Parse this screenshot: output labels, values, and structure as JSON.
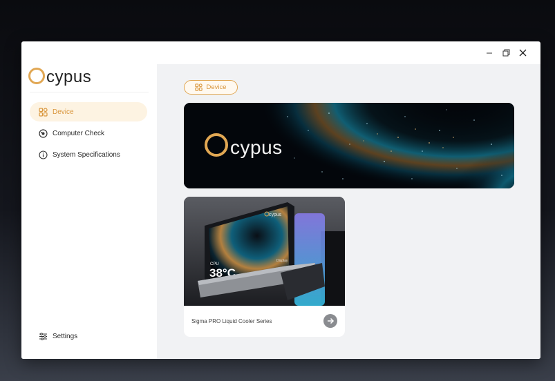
{
  "app": {
    "logo_text": "cypus"
  },
  "window_controls": [
    "minimize-icon",
    "restore-icon",
    "close-icon"
  ],
  "sidebar": {
    "items": [
      {
        "label": "Device",
        "icon": "grid-icon",
        "active": true
      },
      {
        "label": "Computer Check",
        "icon": "gauge-icon",
        "active": false
      },
      {
        "label": "System Specifications",
        "icon": "info-icon",
        "active": false
      }
    ],
    "settings_label": "Settings"
  },
  "main": {
    "device_pill_label": "Device",
    "banner": {
      "logo_text": "cypus"
    },
    "product_card": {
      "name": "Sigma PRO Liquid Cooler Series",
      "screen_brand": "cypus",
      "screen_cpu_label": "CPU",
      "screen_temp": "38°C",
      "screen_side_label": "Display"
    }
  },
  "colors": {
    "accent": "#e1a753",
    "active_bg": "#fdf3e2",
    "content_bg": "#f1f2f4"
  }
}
